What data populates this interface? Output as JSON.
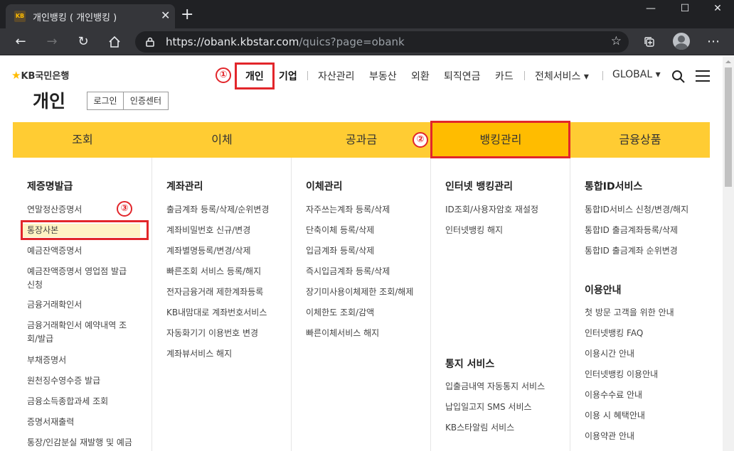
{
  "browser": {
    "tab_title": "개인뱅킹 ( 개인뱅킹 )",
    "tab_favicon_text": "KB",
    "url_scheme": "https://",
    "url_host": "obank.kbstar.com",
    "url_path": "/quics?page=obank"
  },
  "header": {
    "logo_text": "KB국민은행",
    "page_title": "개인",
    "login_label": "로그인",
    "cert_label": "인증센터",
    "nav": {
      "personal": "개인",
      "business": "기업",
      "asset": "자산관리",
      "realestate": "부동산",
      "fx": "외환",
      "pension": "퇴직연금",
      "card": "카드",
      "all_services": "전체서비스 ▾",
      "global": "GLOBAL ▾"
    }
  },
  "gnb": [
    "조회",
    "이체",
    "공과금",
    "뱅킹관리",
    "금융상품"
  ],
  "columns": {
    "c1": {
      "title": "제증명발급",
      "links": [
        "연말정산증명서",
        "통장사본",
        "예금잔액증명서",
        "예금잔액증명서 영업점 발급 신청",
        "금융거래확인서",
        "금융거래확인서 예약내역 조회/발급",
        "부채증명서",
        "원천징수영수증 발급",
        "금융소득종합과세 조회",
        "증명서재출력",
        "통장/인감분실 재발행 및 예금"
      ]
    },
    "c2": {
      "title": "계좌관리",
      "links": [
        "출금계좌 등록/삭제/순위변경",
        "계좌비밀번호 신규/변경",
        "계좌별명등록/변경/삭제",
        "빠른조회 서비스 등록/해지",
        "전자금융거래 제한계좌등록",
        "KB내맘대로 계좌번호서비스",
        "자동화기기 이용번호 변경",
        "계좌뷰서비스 해지"
      ]
    },
    "c3": {
      "title": "이체관리",
      "links": [
        "자주쓰는계좌 등록/삭제",
        "단축이체 등록/삭제",
        "입금계좌 등록/삭제",
        "즉시입금계좌 등록/삭제",
        "장기미사용이체제한 조회/해제",
        "이체한도 조회/감액",
        "빠른이체서비스 해지"
      ]
    },
    "c4": {
      "title": "인터넷 뱅킹관리",
      "links": [
        "ID조회/사용자암호 재설정",
        "인터넷뱅킹 해지"
      ],
      "title2": "통지 서비스",
      "links2": [
        "입출금내역 자동통지 서비스",
        "납입일고지 SMS 서비스",
        "KB스타알림 서비스"
      ]
    },
    "c5": {
      "title": "통합ID서비스",
      "links": [
        "통합ID서비스 신청/변경/해지",
        "통합ID 출금계좌등록/삭제",
        "통합ID 출금계좌 순위변경"
      ],
      "title2": "이용안내",
      "links2": [
        "첫 방문 고객을 위한 안내",
        "인터넷뱅킹 FAQ",
        "이용시간 안내",
        "인터넷뱅킹 이용안내",
        "이용수수료 안내",
        "이용 시 혜택안내",
        "이용약관 안내"
      ]
    }
  },
  "annotations": [
    "①",
    "②",
    "③"
  ],
  "colors": {
    "gnb_bg": "#ffcc33",
    "gnb_active": "#ffbc00",
    "annotation": "#e2262b",
    "brand": "#ffbc00"
  }
}
